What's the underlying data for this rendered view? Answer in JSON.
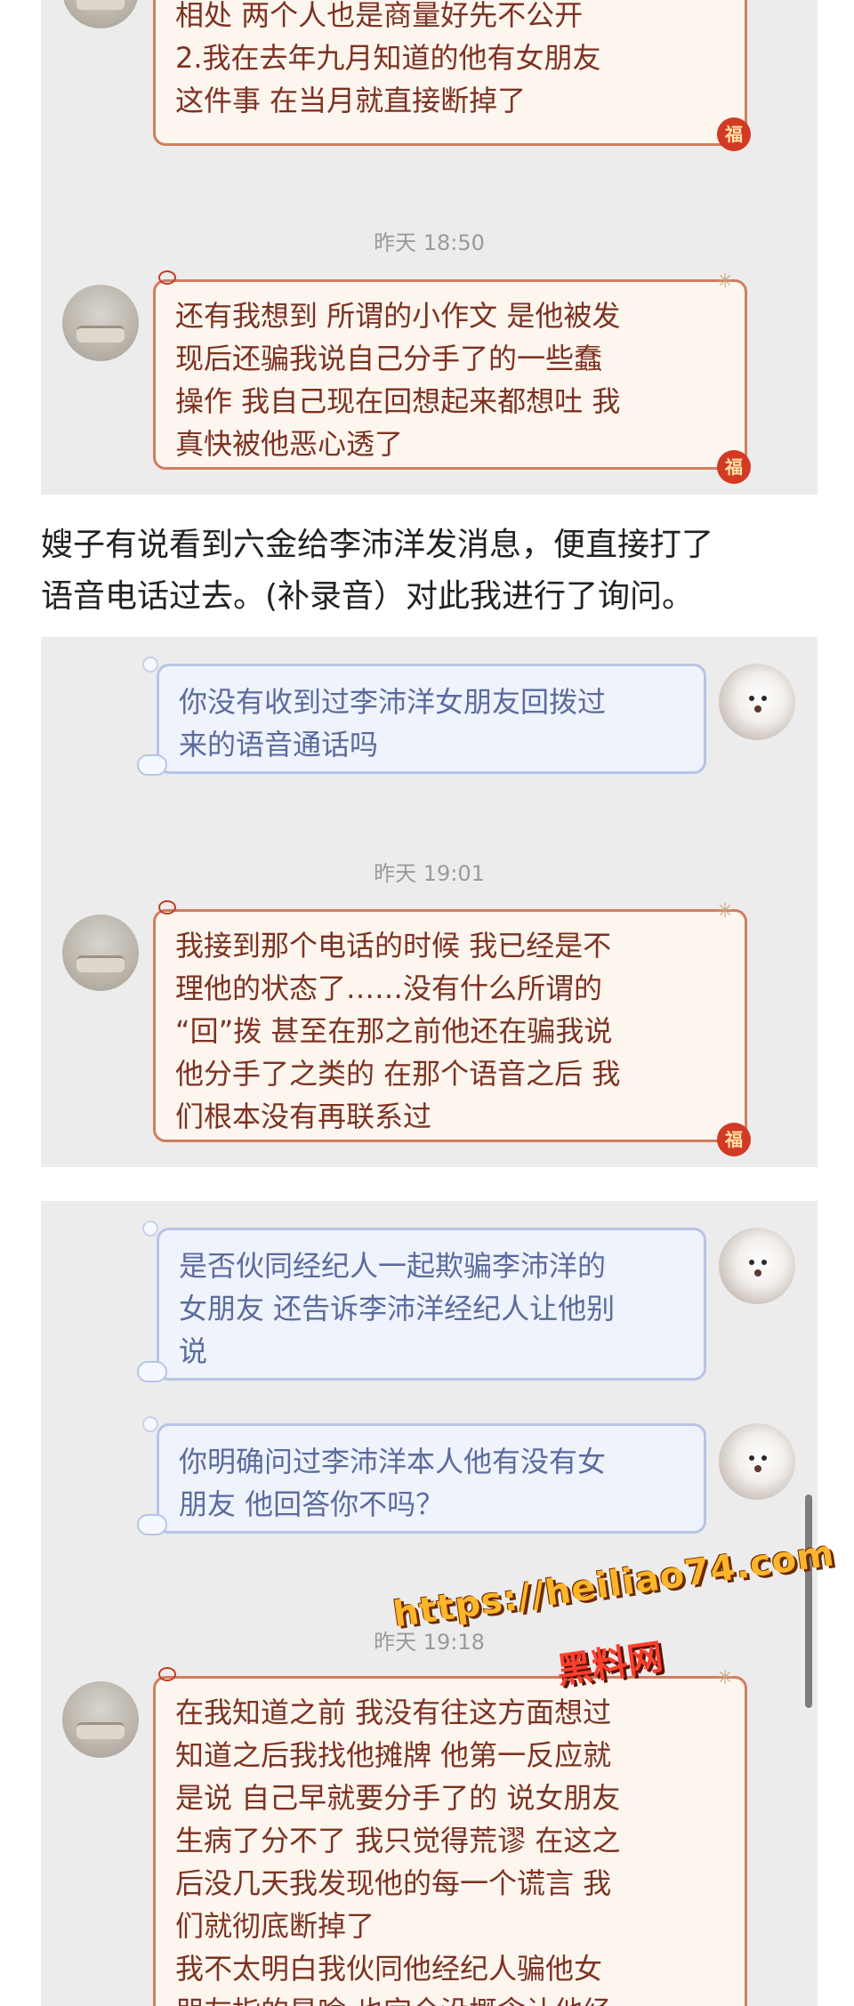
{
  "panels": [
    {
      "messages": [
        {
          "side": "left",
          "text": "相处 两个人也是商量好先不公开\n2.我在去年九月知道的他有女朋友\n这件事 在当月就直接断掉了"
        },
        {
          "timestamp": "昨天 18:50"
        },
        {
          "side": "left",
          "text": "还有我想到 所谓的小作文 是他被发\n现后还骗我说自己分手了的一些蠢\n操作 我自己现在回想起来都想吐 我\n真快被他恶心透了"
        }
      ]
    },
    {
      "messages": [
        {
          "side": "right",
          "text": "你没有收到过李沛洋女朋友回拨过\n来的语音通话吗"
        },
        {
          "timestamp": "昨天 19:01"
        },
        {
          "side": "left",
          "text": "我接到那个电话的时候 我已经是不\n理他的状态了……没有什么所谓的\n“回”拨 甚至在那之前他还在骗我说\n他分手了之类的 在那个语音之后 我\n们根本没有再联系过"
        }
      ]
    },
    {
      "messages": [
        {
          "side": "right",
          "text": "是否伙同经纪人一起欺骗李沛洋的\n女朋友 还告诉李沛洋经纪人让他别\n说"
        },
        {
          "side": "right",
          "text": "你明确问过李沛洋本人他有没有女\n朋友 他回答你不吗？"
        },
        {
          "timestamp": "昨天 19:18"
        },
        {
          "side": "left",
          "text": "在我知道之前 我没有往这方面想过\n知道之后我找他摊牌 他第一反应就\n是说 自己早就要分手了的 说女朋友\n生病了分不了 我只觉得荒谬 在这之\n后没几天我发现他的每一个谎言 我\n们就彻底断掉了\n我不太明白我伙同他经纪人骗他女\n朋友指的是啥 也完全没概念让他经"
        }
      ]
    }
  ],
  "caption": "嫂子有说看到六金给李沛洋发消息，便直接打了\n语音电话过去。(补录音）对此我进行了询问。",
  "sticker_label": "福",
  "watermark": {
    "url": "https://heiliao74.com",
    "name": "黑料网"
  },
  "colors": {
    "left_bubble_border": "#d27d60",
    "left_text": "#7d3222",
    "right_bubble_border": "#b8c4e6",
    "right_text": "#5c6b9e",
    "panel_bg": "#ececec"
  }
}
